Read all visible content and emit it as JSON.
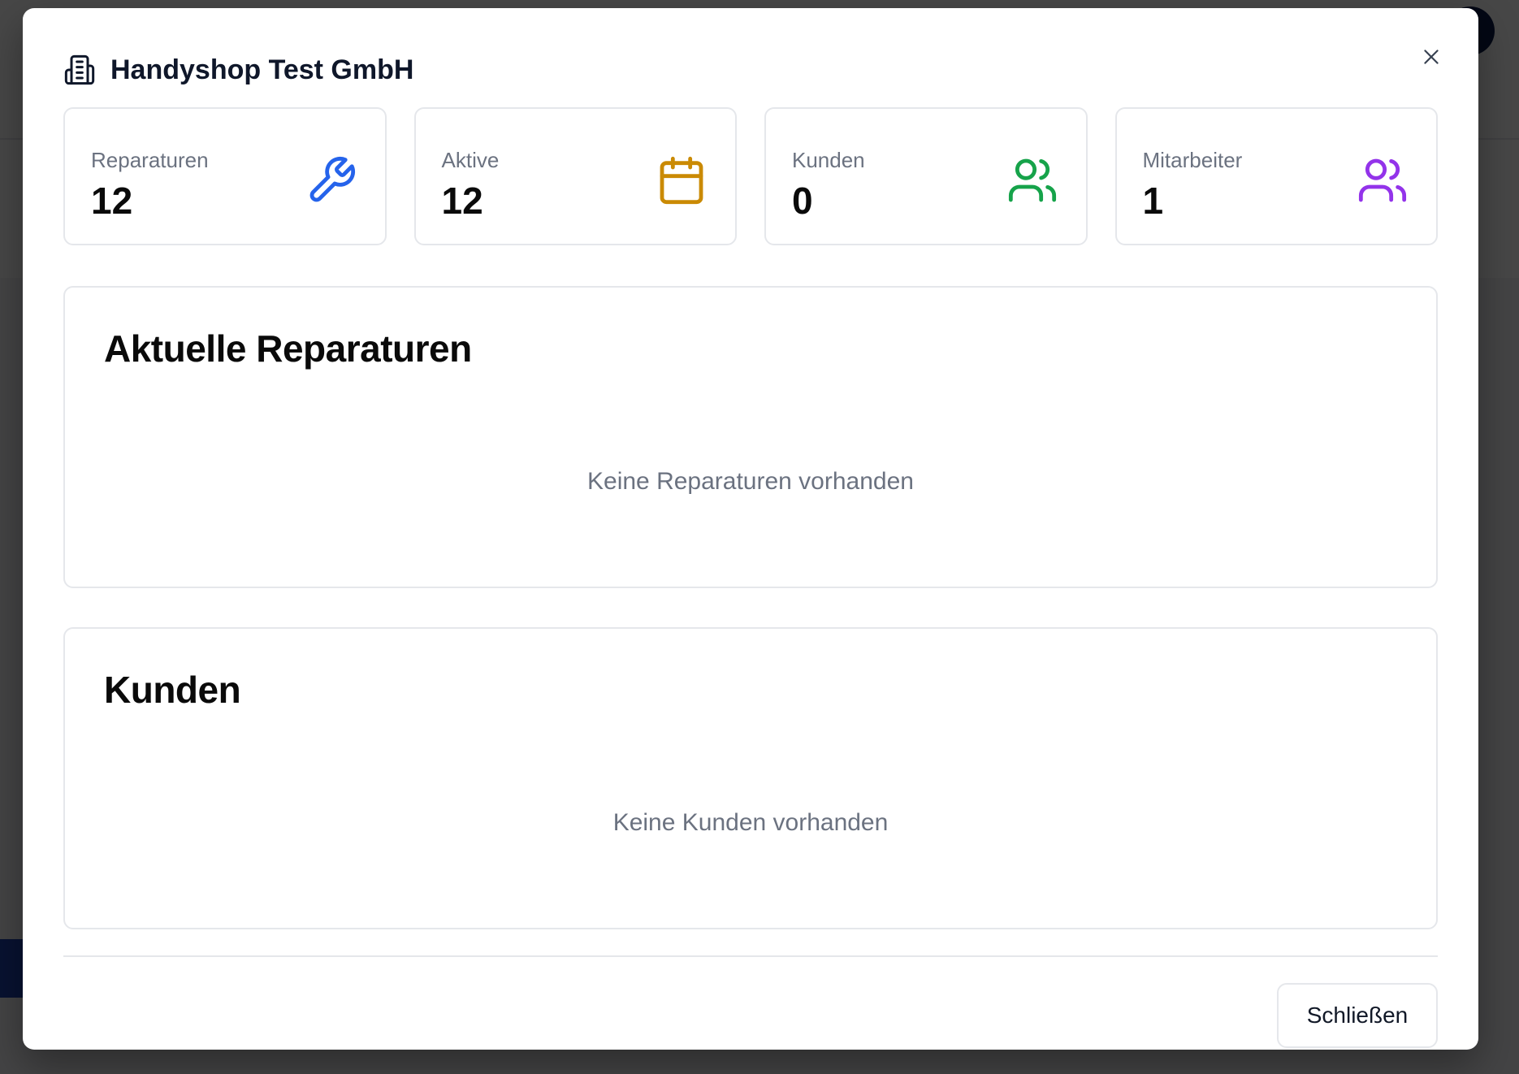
{
  "modal": {
    "title": "Handyshop Test GmbH",
    "icons": {
      "header": "building-icon",
      "close": "close-icon"
    },
    "stats": [
      {
        "label": "Reparaturen",
        "value": "12",
        "icon": "wrench-icon",
        "color": "#2563eb"
      },
      {
        "label": "Aktive",
        "value": "12",
        "icon": "calendar-icon",
        "color": "#ca8a04"
      },
      {
        "label": "Kunden",
        "value": "0",
        "icon": "users-icon",
        "color": "#16a34a"
      },
      {
        "label": "Mitarbeiter",
        "value": "1",
        "icon": "users-icon",
        "color": "#9333ea"
      }
    ],
    "repairs_section": {
      "title": "Aktuelle Reparaturen",
      "empty_text": "Keine Reparaturen vorhanden"
    },
    "customers_section": {
      "title": "Kunden",
      "empty_text": "Keine Kunden vorhanden"
    },
    "close_button_label": "Schließen"
  }
}
